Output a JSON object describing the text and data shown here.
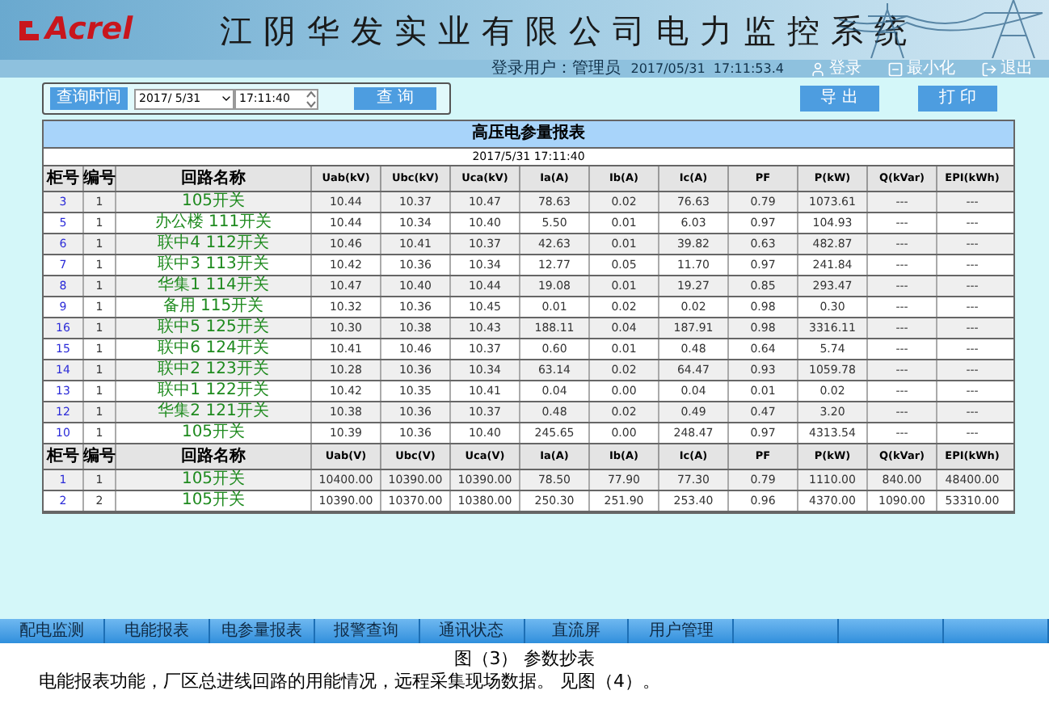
{
  "header": {
    "logo": "Acrel",
    "title": "江阴华发实业有限公司电力监控系统",
    "user_label": "登录用户：",
    "user": "管理员",
    "datetime": "2017/05/31  17:11:53.4",
    "actions": [
      {
        "kind": "login",
        "label": "登录"
      },
      {
        "kind": "minimize",
        "label": "最小化"
      },
      {
        "kind": "exit",
        "label": "退出"
      }
    ]
  },
  "toolbar": {
    "query_label": "查询时间",
    "date": "2017/ 5/31",
    "time": "17:11:40",
    "query_button": "查 询",
    "export_button": "导 出",
    "print_button": "打 印"
  },
  "report": {
    "title": "高压电参量报表",
    "timestamp": "2017/5/31 17:11:40",
    "sections": [
      {
        "columns": [
          "柜号",
          "编号",
          "回路名称",
          "Uab(kV)",
          "Ubc(kV)",
          "Uca(kV)",
          "Ia(A)",
          "Ib(A)",
          "Ic(A)",
          "PF",
          "P(kW)",
          "Q(kVar)",
          "EPI(kWh)"
        ],
        "rows": [
          [
            "3",
            "1",
            "105开关",
            "10.44",
            "10.37",
            "10.47",
            "78.63",
            "0.02",
            "76.63",
            "0.79",
            "1073.61",
            "---",
            "---"
          ],
          [
            "5",
            "1",
            "办公楼 111开关",
            "10.44",
            "10.34",
            "10.40",
            "5.50",
            "0.01",
            "6.03",
            "0.97",
            "104.93",
            "---",
            "---"
          ],
          [
            "6",
            "1",
            "联中4 112开关",
            "10.46",
            "10.41",
            "10.37",
            "42.63",
            "0.01",
            "39.82",
            "0.63",
            "482.87",
            "---",
            "---"
          ],
          [
            "7",
            "1",
            "联中3 113开关",
            "10.42",
            "10.36",
            "10.34",
            "12.77",
            "0.05",
            "11.70",
            "0.97",
            "241.84",
            "---",
            "---"
          ],
          [
            "8",
            "1",
            "华集1 114开关",
            "10.47",
            "10.40",
            "10.44",
            "19.08",
            "0.01",
            "19.27",
            "0.85",
            "293.47",
            "---",
            "---"
          ],
          [
            "9",
            "1",
            "备用 115开关",
            "10.32",
            "10.36",
            "10.45",
            "0.01",
            "0.02",
            "0.02",
            "0.98",
            "0.30",
            "---",
            "---"
          ],
          [
            "16",
            "1",
            "联中5 125开关",
            "10.30",
            "10.38",
            "10.43",
            "188.11",
            "0.04",
            "187.91",
            "0.98",
            "3316.11",
            "---",
            "---"
          ],
          [
            "15",
            "1",
            "联中6 124开关",
            "10.41",
            "10.46",
            "10.37",
            "0.60",
            "0.01",
            "0.48",
            "0.64",
            "5.74",
            "---",
            "---"
          ],
          [
            "14",
            "1",
            "联中2 123开关",
            "10.28",
            "10.36",
            "10.34",
            "63.14",
            "0.02",
            "64.47",
            "0.93",
            "1059.78",
            "---",
            "---"
          ],
          [
            "13",
            "1",
            "联中1 122开关",
            "10.42",
            "10.35",
            "10.41",
            "0.04",
            "0.00",
            "0.04",
            "0.01",
            "0.02",
            "---",
            "---"
          ],
          [
            "12",
            "1",
            "华集2 121开关",
            "10.38",
            "10.36",
            "10.37",
            "0.48",
            "0.02",
            "0.49",
            "0.47",
            "3.20",
            "---",
            "---"
          ],
          [
            "10",
            "1",
            "105开关",
            "10.39",
            "10.36",
            "10.40",
            "245.65",
            "0.00",
            "248.47",
            "0.97",
            "4313.54",
            "---",
            "---"
          ]
        ]
      },
      {
        "columns": [
          "柜号",
          "编号",
          "回路名称",
          "Uab(V)",
          "Ubc(V)",
          "Uca(V)",
          "Ia(A)",
          "Ib(A)",
          "Ic(A)",
          "PF",
          "P(kW)",
          "Q(kVar)",
          "EPI(kWh)"
        ],
        "rows": [
          [
            "1",
            "1",
            "105开关",
            "10400.00",
            "10390.00",
            "10390.00",
            "78.50",
            "77.90",
            "77.30",
            "0.79",
            "1110.00",
            "840.00",
            "48400.00"
          ],
          [
            "2",
            "2",
            "105开关",
            "10390.00",
            "10370.00",
            "10380.00",
            "250.30",
            "251.90",
            "253.40",
            "0.96",
            "4370.00",
            "1090.00",
            "53310.00"
          ]
        ]
      }
    ]
  },
  "nav": {
    "items": [
      "配电监测",
      "电能报表",
      "电参量报表",
      "报警查询",
      "通讯状态",
      "直流屏",
      "用户管理"
    ]
  },
  "caption": {
    "figure": "图（3） 参数抄表",
    "text": "电能报表功能，厂区总进线回路的用能情况，远程采集现场数据。 见图（4）。"
  }
}
